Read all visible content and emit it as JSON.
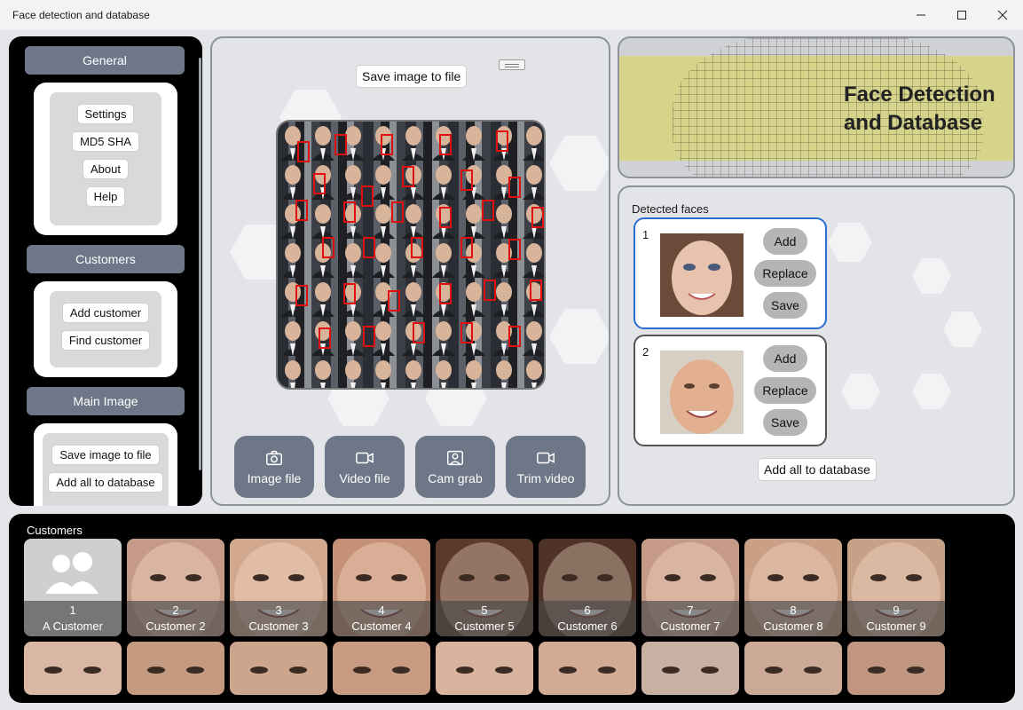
{
  "window": {
    "title": "Face detection and database",
    "minimize_icon": "minimize-icon",
    "maximize_icon": "maximize-icon",
    "close_icon": "close-icon"
  },
  "sidebar": {
    "general": {
      "header": "General",
      "items": [
        "Settings",
        "MD5 SHA",
        "About",
        "Help"
      ]
    },
    "customers": {
      "header": "Customers",
      "items": [
        "Add customer",
        "Find customer"
      ]
    },
    "main_image": {
      "header": "Main Image",
      "items": [
        "Save image to file",
        "Add all to database"
      ]
    }
  },
  "center": {
    "save_button": "Save image to file",
    "tools": [
      {
        "label": "Image file",
        "icon": "camera-icon"
      },
      {
        "label": "Video file",
        "icon": "video-camera-icon"
      },
      {
        "label": "Cam grab",
        "icon": "portrait-icon"
      },
      {
        "label": "Trim video",
        "icon": "video-camera-icon"
      }
    ]
  },
  "banner": {
    "title_line1": "Face Detection",
    "title_line2": "and Database"
  },
  "detected": {
    "label": "Detected faces",
    "faces": [
      {
        "number": "1",
        "add": "Add",
        "replace": "Replace",
        "save": "Save",
        "selected": true
      },
      {
        "number": "2",
        "add": "Add",
        "replace": "Replace",
        "save": "Save",
        "selected": false
      }
    ],
    "add_all": "Add all to database"
  },
  "customers_panel": {
    "label": "Customers",
    "tiles": [
      {
        "number": "1",
        "name": "A Customer",
        "placeholder": true
      },
      {
        "number": "2",
        "name": "Customer 2"
      },
      {
        "number": "3",
        "name": "Customer 3"
      },
      {
        "number": "4",
        "name": "Customer 4"
      },
      {
        "number": "5",
        "name": "Customer 5"
      },
      {
        "number": "6",
        "name": "Customer 6"
      },
      {
        "number": "7",
        "name": "Customer 7"
      },
      {
        "number": "8",
        "name": "Customer 8"
      },
      {
        "number": "9",
        "name": "Customer 9"
      }
    ]
  }
}
